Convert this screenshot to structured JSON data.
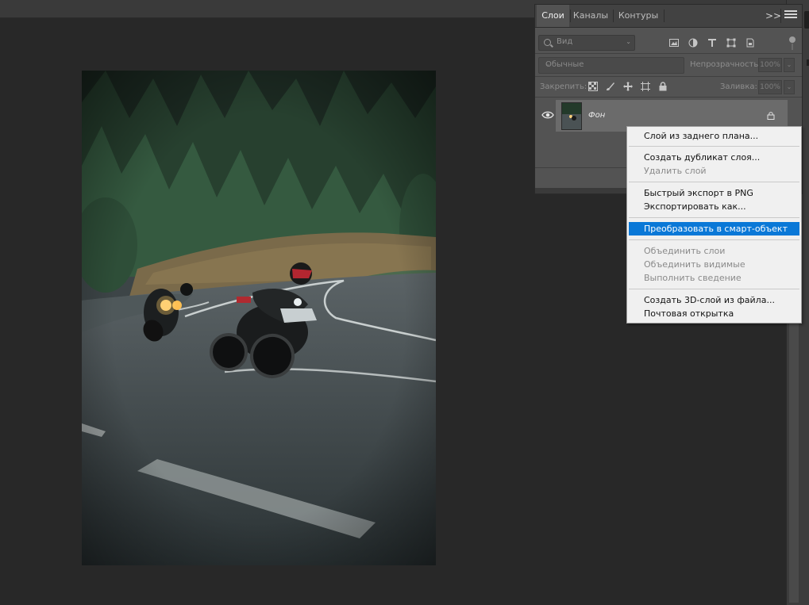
{
  "panel": {
    "tabs": [
      {
        "label": "Слои",
        "active": true
      },
      {
        "label": "Каналы",
        "active": false
      },
      {
        "label": "Контуры",
        "active": false
      }
    ],
    "collapse_label": ">>",
    "filter": {
      "placeholder": "Вид"
    },
    "blend_mode": "Обычные",
    "opacity_label": "Непрозрачность:",
    "opacity_value": "100%",
    "lock_label": "Закрепить:",
    "fill_label": "Заливка:",
    "fill_value": "100%",
    "layers": [
      {
        "name": "Фон",
        "visible": true,
        "locked": true
      }
    ]
  },
  "context_menu": {
    "groups": [
      [
        {
          "label": "Слой из заднего плана...",
          "enabled": true
        }
      ],
      [
        {
          "label": "Создать дубликат слоя...",
          "enabled": true
        },
        {
          "label": "Удалить слой",
          "enabled": false
        }
      ],
      [
        {
          "label": "Быстрый экспорт в PNG",
          "enabled": true
        },
        {
          "label": "Экспортировать как...",
          "enabled": true
        }
      ],
      [
        {
          "label": "Преобразовать в смарт-объект",
          "enabled": true,
          "highlighted": true
        }
      ],
      [
        {
          "label": "Объединить слои",
          "enabled": false
        },
        {
          "label": "Объединить видимые",
          "enabled": false
        },
        {
          "label": "Выполнить сведение",
          "enabled": false
        }
      ],
      [
        {
          "label": "Создать 3D-слой из файла...",
          "enabled": true
        },
        {
          "label": "Почтовая открытка",
          "enabled": true
        }
      ]
    ]
  },
  "colors": {
    "highlight": "#0a78d7",
    "panel_bg": "#535353",
    "canvas_bg": "#282828"
  }
}
